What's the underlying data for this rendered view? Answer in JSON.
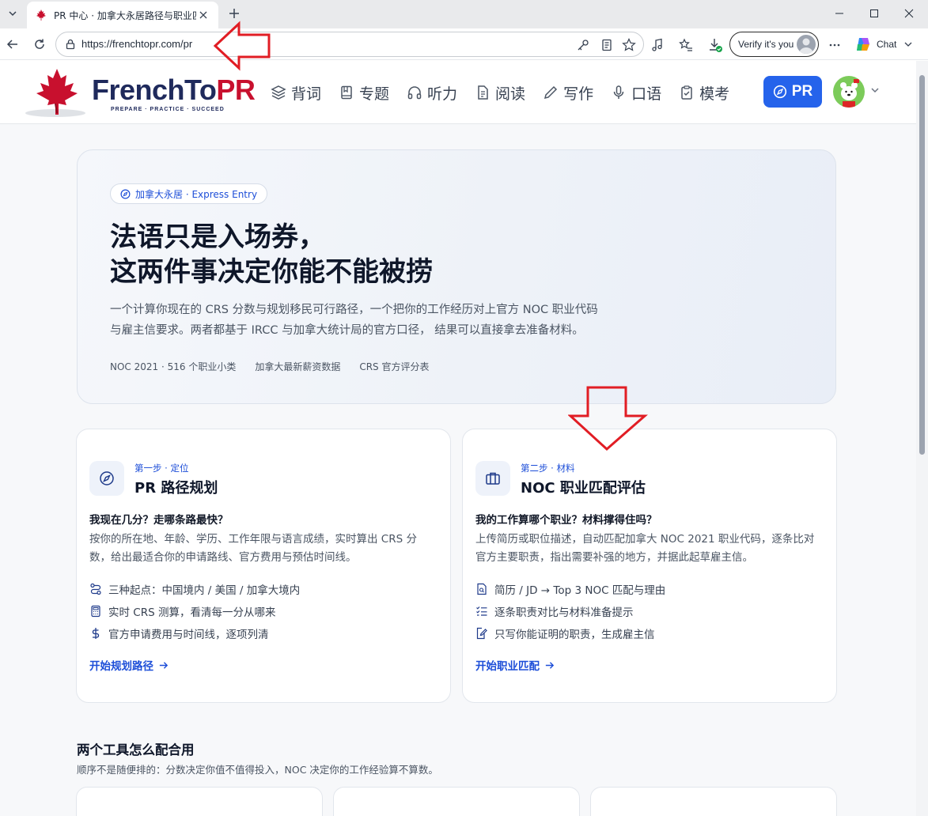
{
  "browser": {
    "tab_title": "PR 中心 · 加拿大永居路径与职业匹配",
    "url": "https://frenchtopr.com/pr",
    "verify_label": "Verify it's you",
    "chat_label": "Chat"
  },
  "site": {
    "logo_main": "FrenchTo",
    "logo_accent": "PR",
    "logo_tagline": "PREPARE · PRACTICE · SUCCEED",
    "nav": [
      {
        "label": "背词",
        "icon": "layers-icon"
      },
      {
        "label": "专题",
        "icon": "book-icon"
      },
      {
        "label": "听力",
        "icon": "headphones-icon"
      },
      {
        "label": "阅读",
        "icon": "document-icon"
      },
      {
        "label": "写作",
        "icon": "pencil-icon"
      },
      {
        "label": "口语",
        "icon": "microphone-icon"
      },
      {
        "label": "模考",
        "icon": "clipboard-icon"
      }
    ],
    "pr_button": "PR"
  },
  "hero": {
    "pill": "加拿大永居 · Express Entry",
    "title_line1": "法语只是入场券，",
    "title_line2": "这两件事决定你能不能被捞",
    "desc_line1": "一个计算你现在的 CRS 分数与规划移民可行路径，一个把你的工作经历对上官方 NOC 职业代码",
    "desc_line2": "与雇主信要求。两者都基于 IRCC 与加拿大统计局的官方口径， 结果可以直接拿去准备材料。",
    "meta": [
      "NOC 2021 · 516 个职业小类",
      "加拿大最新薪资数据",
      "CRS 官方评分表"
    ]
  },
  "cards": [
    {
      "step": "第一步 · 定位",
      "title": "PR 路径规划",
      "question": "我现在几分？走哪条路最快？",
      "desc": "按你的所在地、年龄、学历、工作年限与语言成绩，实时算出 CRS 分数，给出最适合你的申请路线、官方费用与预估时间线。",
      "features": [
        "三种起点：中国境内 / 美国 / 加拿大境内",
        "实时 CRS 测算，看清每一分从哪来",
        "官方申请费用与时间线，逐项列清"
      ],
      "link": "开始规划路径"
    },
    {
      "step": "第二步 · 材料",
      "title": "NOC 职业匹配评估",
      "question": "我的工作算哪个职业？材料撑得住吗？",
      "desc": "上传简历或职位描述，自动匹配加拿大 NOC 2021 职业代码，逐条比对官方主要职责，指出需要补强的地方，并据此起草雇主信。",
      "features": [
        "简历 / JD → Top 3 NOC 匹配与理由",
        "逐条职责对比与材料准备提示",
        "只写你能证明的职责，生成雇主信"
      ],
      "link": "开始职业匹配"
    }
  ],
  "section": {
    "title": "两个工具怎么配合用",
    "subtitle": "顺序不是随便排的：分数决定你值不值得投入，NOC 决定你的工作经验算不算数。"
  },
  "colors": {
    "accent": "#2563eb",
    "brand_navy": "#1f2a5c",
    "brand_red": "#c8102e",
    "annotation_red": "#e11d24"
  }
}
